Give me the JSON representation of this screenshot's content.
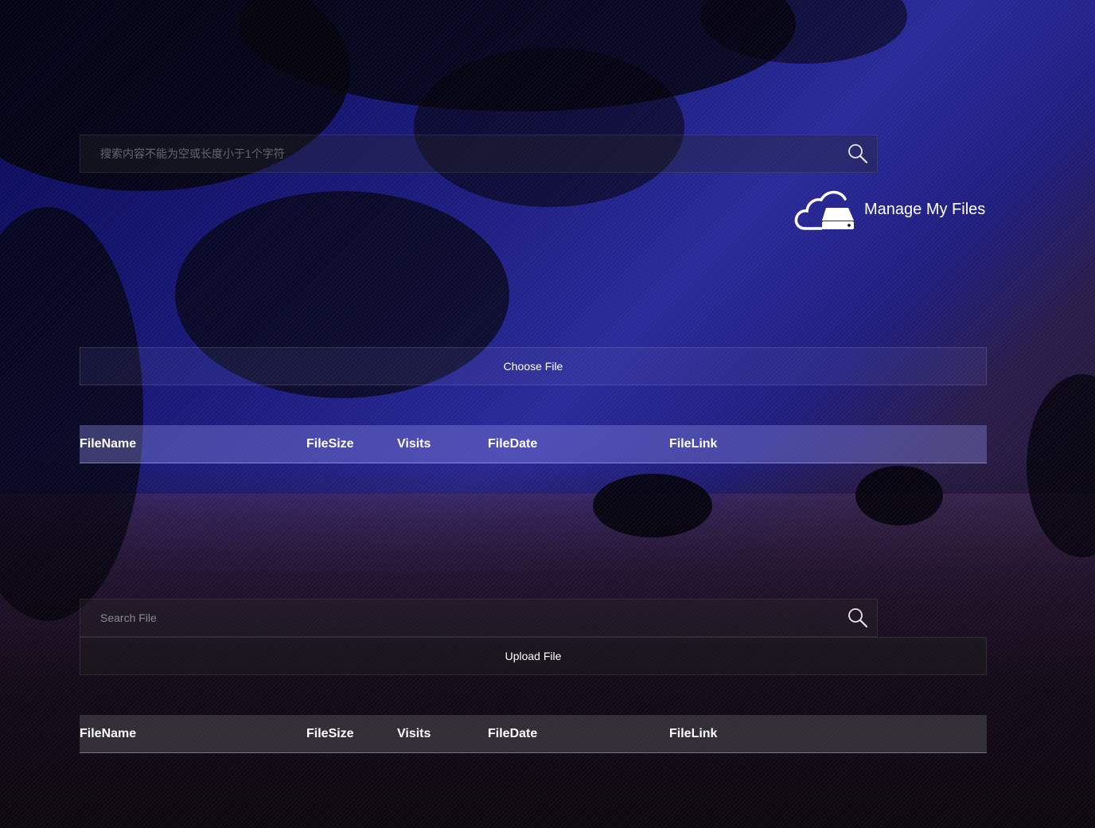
{
  "top_search": {
    "placeholder": "搜索内容不能为空或长度小于1个字符"
  },
  "brand": {
    "label": "Manage My Files",
    "icon": "cloud-drive-icon"
  },
  "choose_file": {
    "label": "Choose File"
  },
  "table_headers": [
    "FileName",
    "FileSize",
    "Visits",
    "FileDate",
    "FileLink"
  ],
  "bottom_search": {
    "placeholder": "Search File"
  },
  "upload_file": {
    "label": "Upload File"
  },
  "icons": {
    "search": "search-icon"
  }
}
